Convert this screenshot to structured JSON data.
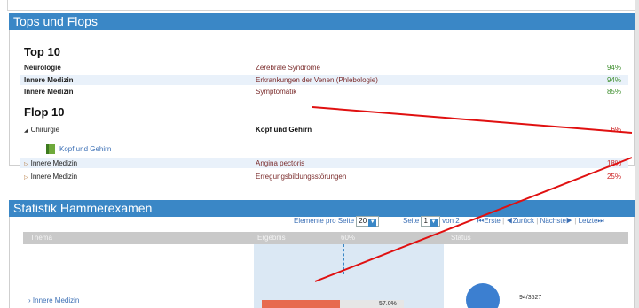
{
  "tops_flops": {
    "header": "Tops und Flops",
    "top_title": "Top 10",
    "top_rows": [
      {
        "subject": "Neurologie",
        "topic": "Zerebrale Syndrome",
        "pct": "94%"
      },
      {
        "subject": "Innere Medizin",
        "topic": "Erkrankungen der Venen (Phlebologie)",
        "pct": "94%"
      },
      {
        "subject": "Innere Medizin",
        "topic": "Symptomatik",
        "pct": "85%"
      }
    ],
    "flop_title": "Flop 10",
    "flop_rows": [
      {
        "subject": "Chirurgie",
        "topic": "Kopf und Gehirn",
        "pct": "6%"
      },
      {
        "subject": "Innere Medizin",
        "topic": "Angina pectoris",
        "pct": "18%"
      },
      {
        "subject": "Innere Medizin",
        "topic": "Erregungsbildungsstörungen",
        "pct": "25%"
      }
    ],
    "flop_sub_item": "Kopf und Gehirn"
  },
  "statistik": {
    "header": "Statistik Hammerexamen",
    "per_page_label": "Elemente pro Seite",
    "per_page_value": "20",
    "page_label": "Seite",
    "page_value": "1",
    "page_of": "von 2",
    "nav": {
      "first": "Erste",
      "prev": "Zurück",
      "next": "Nächste",
      "last": "Letzte"
    },
    "columns": {
      "thema": "Thema",
      "ergebnis": "Ergebnis",
      "threshold": "60%",
      "status": "Status"
    },
    "row": {
      "thema": "Innere Medizin",
      "result_label": "57.0%",
      "result_value": 0.57,
      "status": "94/3527"
    }
  },
  "colors": {
    "header_blue": "#3a87c6",
    "bar": "#e76a4f",
    "pie": "#3c7fd0",
    "good": "#3f8f2f",
    "bad": "#cc2222",
    "annotation": "#e01010"
  }
}
